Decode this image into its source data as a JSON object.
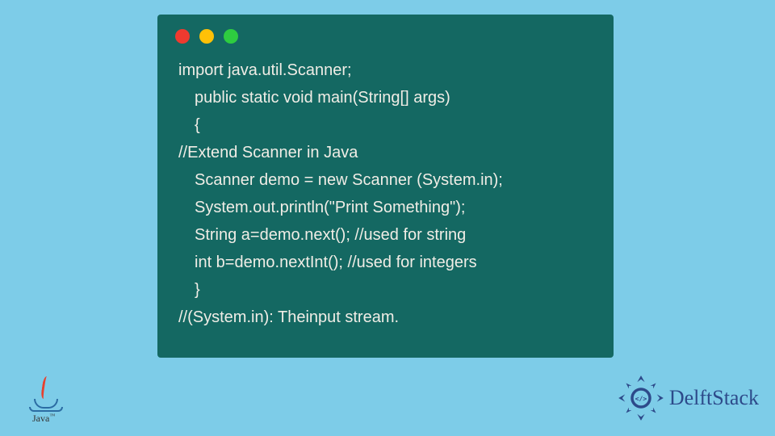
{
  "code": {
    "lines": [
      "import java.util.Scanner;",
      " public static void main(String[] args)",
      " {",
      "//Extend Scanner in Java",
      " Scanner demo = new Scanner (System.in);",
      " System.out.println(\"Print Something\");",
      " String a=demo.next(); //used for string",
      " int b=demo.nextInt(); //used for integers",
      " }",
      "//(System.in): Theinput stream."
    ]
  },
  "logos": {
    "java_label": "Java",
    "java_tm": "™",
    "delft_label": "DelftStack"
  },
  "window": {
    "dots": [
      "red",
      "yellow",
      "green"
    ]
  }
}
